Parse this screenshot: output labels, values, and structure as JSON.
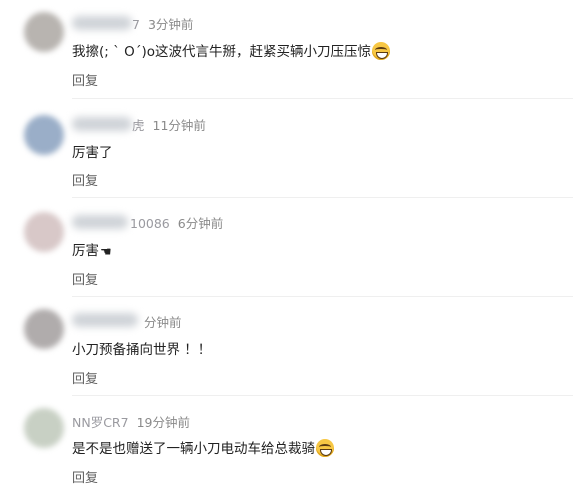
{
  "comments": [
    {
      "username": "7",
      "time": "3分钟前",
      "text": "我擦(; ` O´)o这波代言牛掰，赶紧买辆小刀压压惊",
      "emoji": "grin-icon",
      "reply": "回复"
    },
    {
      "username": "虎",
      "time": "11分钟前",
      "text": "厉害了",
      "reply": "回复"
    },
    {
      "username": "10086",
      "time": "6分钟前",
      "text": "厉害",
      "emoji": "pointing-hand-icon",
      "reply": "回复"
    },
    {
      "username": "",
      "time": "分钟前",
      "text": "小刀预备捅向世界 ！！",
      "reply": "回复"
    },
    {
      "username": "NN罗CR7",
      "time": "19分钟前",
      "text": "是不是也赠送了一辆小刀电动车给总裁骑",
      "emoji": "laughing-tears-icon",
      "reply": "回复"
    }
  ],
  "colors": {
    "avatar1": "#b8b4b0",
    "avatar2": "#9aaec8",
    "avatar3": "#d8c8c8",
    "avatar4": "#b0acac",
    "avatar5": "#c8d0c4"
  }
}
